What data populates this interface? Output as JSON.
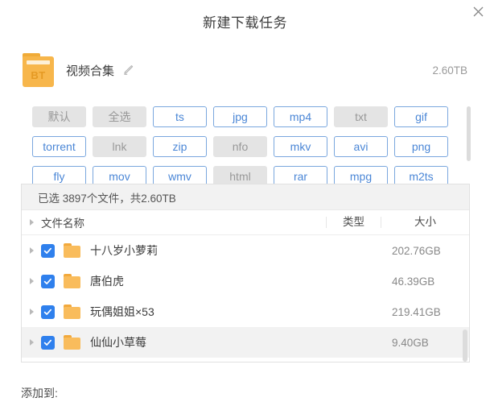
{
  "dialog": {
    "title": "新建下载任务",
    "close_icon": "close-icon"
  },
  "task": {
    "icon_label": "BT",
    "name": "视频合集",
    "edit_icon": "pencil-icon",
    "size": "2.60TB"
  },
  "filters": {
    "rows": [
      [
        {
          "label": "默认",
          "active": false
        },
        {
          "label": "全选",
          "active": false
        },
        {
          "label": "ts",
          "active": true
        },
        {
          "label": "jpg",
          "active": true
        },
        {
          "label": "mp4",
          "active": true
        },
        {
          "label": "txt",
          "active": false
        },
        {
          "label": "gif",
          "active": true
        }
      ],
      [
        {
          "label": "torrent",
          "active": true
        },
        {
          "label": "lnk",
          "active": false
        },
        {
          "label": "zip",
          "active": true
        },
        {
          "label": "nfo",
          "active": false
        },
        {
          "label": "mkv",
          "active": true
        },
        {
          "label": "avi",
          "active": true
        },
        {
          "label": "png",
          "active": true
        }
      ],
      [
        {
          "label": "fly",
          "active": true
        },
        {
          "label": "mov",
          "active": true
        },
        {
          "label": "wmv",
          "active": true
        },
        {
          "label": "html",
          "active": false
        },
        {
          "label": "rar",
          "active": true
        },
        {
          "label": "mpg",
          "active": true
        },
        {
          "label": "m2ts",
          "active": true
        }
      ]
    ]
  },
  "file_panel": {
    "selection_info": "已选 3897个文件，共2.60TB",
    "columns": {
      "name": "文件名称",
      "type": "类型",
      "size": "大小"
    },
    "rows": [
      {
        "name": "十八岁小萝莉",
        "type": "",
        "size": "202.76GB",
        "checked": true,
        "highlighted": false
      },
      {
        "name": "唐伯虎",
        "type": "",
        "size": "46.39GB",
        "checked": true,
        "highlighted": false
      },
      {
        "name": "玩偶姐姐×53",
        "type": "",
        "size": "219.41GB",
        "checked": true,
        "highlighted": false
      },
      {
        "name": "仙仙小草莓",
        "type": "",
        "size": "9.40GB",
        "checked": true,
        "highlighted": true
      }
    ]
  },
  "footer": {
    "add_to_label": "添加到:"
  },
  "colors": {
    "accent_blue": "#4a86d6",
    "checkbox_blue": "#2f80ed",
    "folder_orange": "#f9bc5c",
    "bt_orange": "#f7b64b",
    "chip_off_bg": "#e4e4e4",
    "panel_border": "#e1e1e1",
    "highlight_row": "#f2f2f2"
  }
}
